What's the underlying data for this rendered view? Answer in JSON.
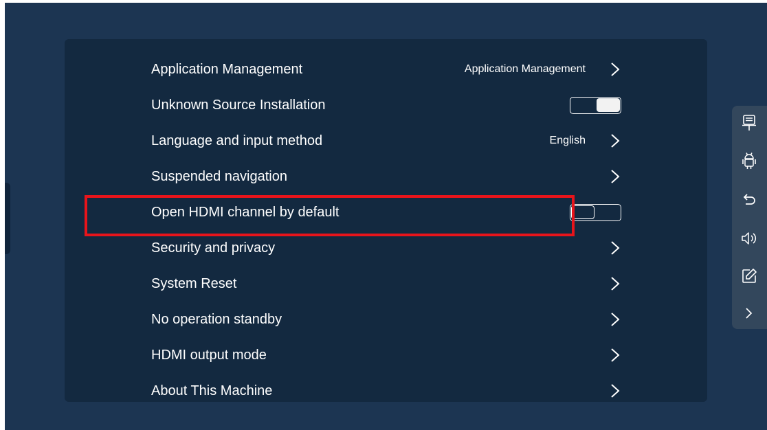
{
  "settings": {
    "rows": [
      {
        "label": "Application Management",
        "value": "Application Management",
        "control": "chevron"
      },
      {
        "label": "Unknown Source Installation",
        "value": "",
        "control": "toggle",
        "toggle_state": "on"
      },
      {
        "label": "Language and input method",
        "value": "English",
        "control": "chevron"
      },
      {
        "label": "Suspended navigation",
        "value": "",
        "control": "chevron"
      },
      {
        "label": "Open HDMI channel by default",
        "value": "",
        "control": "toggle",
        "toggle_state": "off",
        "highlighted": true
      },
      {
        "label": "Security and privacy",
        "value": "",
        "control": "chevron"
      },
      {
        "label": "System Reset",
        "value": "",
        "control": "chevron"
      },
      {
        "label": "No operation standby",
        "value": "",
        "control": "chevron"
      },
      {
        "label": "HDMI output mode",
        "value": "",
        "control": "chevron"
      },
      {
        "label": "About This Machine",
        "value": "",
        "control": "chevron"
      }
    ]
  },
  "side_toolbar": {
    "icons": [
      "computer-icon",
      "android-icon",
      "back-icon",
      "volume-icon",
      "annotate-icon",
      "chevron-right-icon"
    ]
  },
  "colors": {
    "background": "#1c3552",
    "panel": "#132940",
    "toolbar": "#33475c",
    "highlight": "#e8141b",
    "text": "#ffffff"
  }
}
